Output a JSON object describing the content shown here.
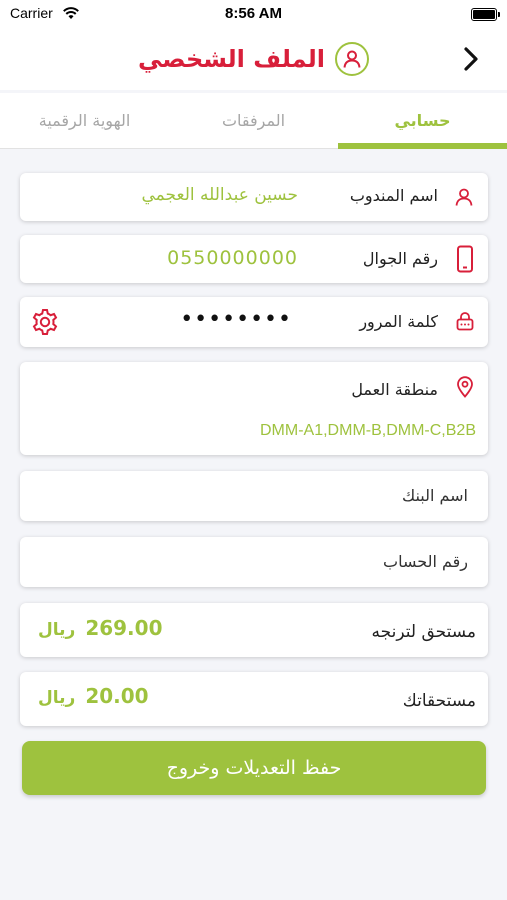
{
  "status_bar": {
    "carrier": "Carrier",
    "time": "8:56 AM"
  },
  "header": {
    "title": "الملف الشخصي"
  },
  "tabs": [
    {
      "label": "حسابي",
      "active": true
    },
    {
      "label": "المرفقات",
      "active": false
    },
    {
      "label": "الهوية الرقمية",
      "active": false
    }
  ],
  "fields": {
    "agent_name": {
      "label": "اسم المندوب",
      "value": "حسين عبدالله العجمي"
    },
    "mobile": {
      "label": "رقم الجوال",
      "value": "0550000000"
    },
    "password": {
      "label": "كلمة المرور",
      "value": "••••••••"
    },
    "work_area": {
      "label": "منطقة العمل",
      "value": "DMM-A1,DMM-B,DMM-C,B2B"
    },
    "bank_name": {
      "label": "اسم البنك",
      "value": ""
    },
    "account_number": {
      "label": "رقم الحساب",
      "value": ""
    },
    "due_transfer": {
      "label": "مستحق لترنجه",
      "amount": "269.00",
      "currency": "ريال"
    },
    "dues": {
      "label": "مستحقاتك",
      "amount": "20.00",
      "currency": "ريال"
    }
  },
  "save_button": {
    "label": "حفظ التعديلات وخروج"
  },
  "colors": {
    "accent": "#9ec23e",
    "brand_red": "#d81f3a",
    "background": "#f4f5f9"
  },
  "icons": [
    "back-chevron-icon",
    "user-avatar-icon",
    "user-icon",
    "phone-icon",
    "lock-icon",
    "gear-icon",
    "location-pin-icon"
  ]
}
